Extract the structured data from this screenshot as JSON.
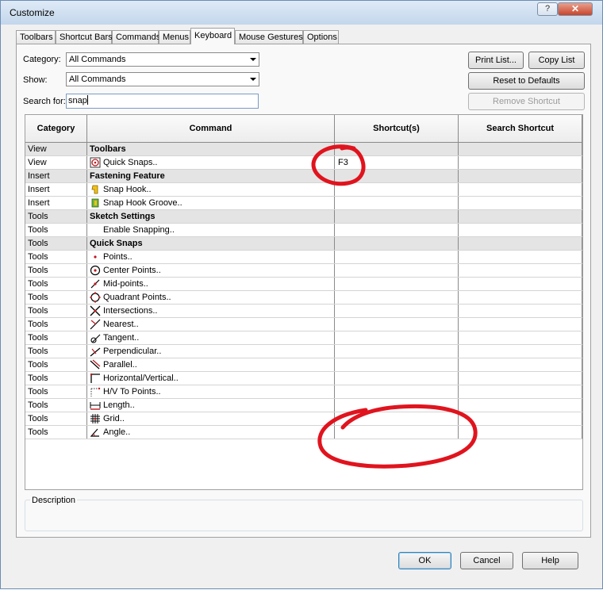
{
  "window": {
    "title": "Customize",
    "help_label": "?",
    "close_label": "✕"
  },
  "tabs": [
    "Toolbars",
    "Shortcut Bars",
    "Commands",
    "Menus",
    "Keyboard",
    "Mouse Gestures",
    "Options"
  ],
  "active_tab": "Keyboard",
  "category": {
    "label": "Category:",
    "value": "All Commands"
  },
  "show": {
    "label": "Show:",
    "value": "All Commands"
  },
  "search": {
    "label": "Search for:",
    "value": "snap"
  },
  "buttons": {
    "print_list": "Print List...",
    "copy_list": "Copy List",
    "reset_defaults": "Reset to Defaults",
    "remove_shortcut": "Remove Shortcut",
    "ok": "OK",
    "cancel": "Cancel",
    "help": "Help"
  },
  "table": {
    "headers": [
      "Category",
      "Command",
      "Shortcut(s)",
      "Search Shortcut"
    ],
    "rows": [
      {
        "category": "View",
        "command": "Toolbars",
        "shortcut": "",
        "group": true,
        "icon": ""
      },
      {
        "category": "View",
        "command": "Quick Snaps..",
        "shortcut": "F3",
        "group": false,
        "icon": "quick-snaps-icon"
      },
      {
        "category": "Insert",
        "command": "Fastening Feature",
        "shortcut": "",
        "group": true,
        "icon": ""
      },
      {
        "category": "Insert",
        "command": "Snap Hook..",
        "shortcut": "",
        "group": false,
        "icon": "snap-hook-icon"
      },
      {
        "category": "Insert",
        "command": "Snap Hook Groove..",
        "shortcut": "",
        "group": false,
        "icon": "snap-hook-groove-icon"
      },
      {
        "category": "Tools",
        "command": "Sketch Settings",
        "shortcut": "",
        "group": true,
        "icon": ""
      },
      {
        "category": "Tools",
        "command": "Enable Snapping..",
        "shortcut": "",
        "group": false,
        "icon": ""
      },
      {
        "category": "Tools",
        "command": "Quick Snaps",
        "shortcut": "",
        "group": true,
        "icon": ""
      },
      {
        "category": "Tools",
        "command": "Points..",
        "shortcut": "",
        "group": false,
        "icon": "point-icon"
      },
      {
        "category": "Tools",
        "command": "Center Points..",
        "shortcut": "",
        "group": false,
        "icon": "center-point-icon"
      },
      {
        "category": "Tools",
        "command": "Mid-points..",
        "shortcut": "",
        "group": false,
        "icon": "midpoint-icon"
      },
      {
        "category": "Tools",
        "command": "Quadrant Points..",
        "shortcut": "",
        "group": false,
        "icon": "quadrant-point-icon"
      },
      {
        "category": "Tools",
        "command": "Intersections..",
        "shortcut": "",
        "group": false,
        "icon": "intersection-icon"
      },
      {
        "category": "Tools",
        "command": "Nearest..",
        "shortcut": "",
        "group": false,
        "icon": "nearest-icon"
      },
      {
        "category": "Tools",
        "command": "Tangent..",
        "shortcut": "",
        "group": false,
        "icon": "tangent-icon"
      },
      {
        "category": "Tools",
        "command": "Perpendicular..",
        "shortcut": "",
        "group": false,
        "icon": "perpendicular-icon"
      },
      {
        "category": "Tools",
        "command": "Parallel..",
        "shortcut": "",
        "group": false,
        "icon": "parallel-icon"
      },
      {
        "category": "Tools",
        "command": "Horizontal/Vertical..",
        "shortcut": "",
        "group": false,
        "icon": "horizontal-vertical-icon"
      },
      {
        "category": "Tools",
        "command": "H/V To Points..",
        "shortcut": "",
        "group": false,
        "icon": "hv-to-points-icon"
      },
      {
        "category": "Tools",
        "command": "Length..",
        "shortcut": "",
        "group": false,
        "icon": "length-icon"
      },
      {
        "category": "Tools",
        "command": "Grid..",
        "shortcut": "",
        "group": false,
        "icon": "grid-icon"
      },
      {
        "category": "Tools",
        "command": "Angle..",
        "shortcut": "",
        "group": false,
        "icon": "angle-icon"
      }
    ]
  },
  "description": {
    "label": "Description"
  },
  "colors": {
    "annotation_red": "#e0141e",
    "icon_red": "#c0181e",
    "window_frame": "#6a8db5"
  }
}
